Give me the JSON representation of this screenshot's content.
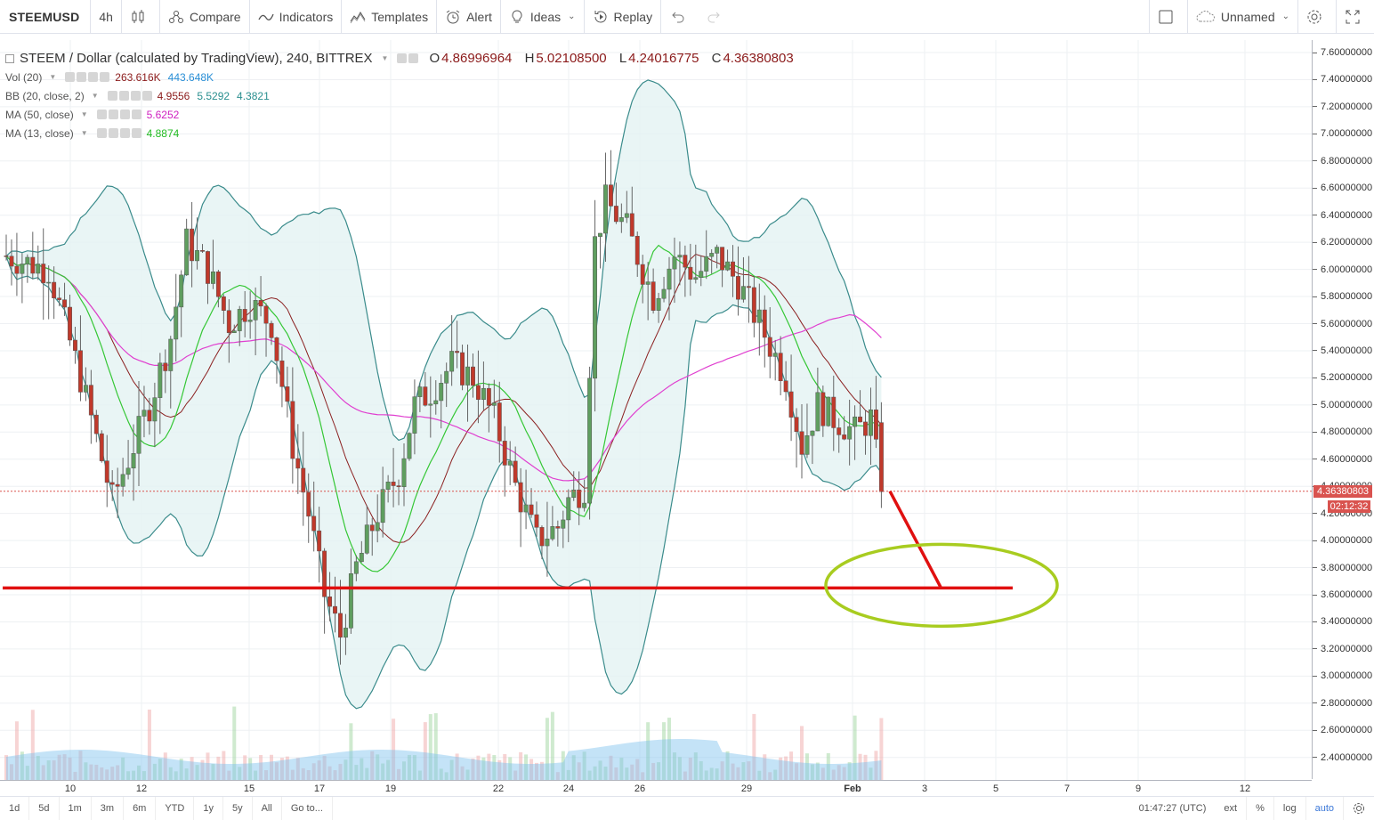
{
  "toolbar": {
    "symbol": "STEEMUSD",
    "interval": "4h",
    "compare": "Compare",
    "indicators": "Indicators",
    "templates": "Templates",
    "alert": "Alert",
    "ideas": "Ideas",
    "replay": "Replay",
    "layout_name": "Unnamed"
  },
  "legend": {
    "title": "STEEM / Dollar (calculated by TradingView), 240, BITTREX",
    "ohlc": {
      "o_label": "O",
      "o": "4.86996964",
      "h_label": "H",
      "h": "5.02108500",
      "l_label": "L",
      "l": "4.24016775",
      "c_label": "C",
      "c": "4.36380803"
    },
    "vol": {
      "name": "Vol (20)",
      "v1": "263.616K",
      "v2": "443.648K"
    },
    "bb": {
      "name": "BB (20, close, 2)",
      "v1": "4.9556",
      "v2": "5.5292",
      "v3": "4.3821"
    },
    "ma50": {
      "name": "MA (50, close)",
      "v1": "5.6252"
    },
    "ma13": {
      "name": "MA (13, close)",
      "v1": "4.8874"
    }
  },
  "price_axis": {
    "ticks": [
      "7.60000000",
      "7.40000000",
      "7.20000000",
      "7.00000000",
      "6.80000000",
      "6.60000000",
      "6.40000000",
      "6.20000000",
      "6.00000000",
      "5.80000000",
      "5.60000000",
      "5.40000000",
      "5.20000000",
      "5.00000000",
      "4.80000000",
      "4.60000000",
      "4.40000000",
      "4.20000000",
      "4.00000000",
      "3.80000000",
      "3.60000000",
      "3.40000000",
      "3.20000000",
      "3.00000000",
      "2.80000000",
      "2.60000000",
      "2.40000000"
    ],
    "last_price": "4.36380803",
    "countdown": "02:12:32"
  },
  "time_axis": {
    "labels": [
      "10",
      "12",
      "15",
      "17",
      "19",
      "22",
      "24",
      "26",
      "29",
      "Feb",
      "3",
      "5",
      "7",
      "9",
      "12"
    ]
  },
  "bottom_bar": {
    "ranges": [
      "1d",
      "5d",
      "1m",
      "3m",
      "6m",
      "YTD",
      "1y",
      "5y",
      "All"
    ],
    "goto": "Go to...",
    "clock": "01:47:27 (UTC)",
    "ext": "ext",
    "percent": "%",
    "log": "log",
    "auto": "auto"
  },
  "colors": {
    "up": "#5f9e5f",
    "down": "#c0392b",
    "bb_line": "#3a8b8b",
    "bb_fill": "#e4f2f2",
    "ma50": "#e040d0",
    "ma13": "#35c735",
    "bb_basis": "#8b2020",
    "support": "#e01010",
    "ellipse": "#a8cc20"
  },
  "chart_data": {
    "type": "candlestick",
    "y_range": [
      2.3,
      7.67
    ],
    "x_labels": [
      "10",
      "12",
      "15",
      "17",
      "19",
      "22",
      "24",
      "26",
      "29",
      "Feb",
      "3",
      "5",
      "7",
      "9",
      "12"
    ],
    "support_level": 3.65,
    "last_close": 4.36380803,
    "indicators": [
      "Vol (20)",
      "BB (20, close, 2)",
      "MA (50, close)",
      "MA (13, close)"
    ]
  }
}
